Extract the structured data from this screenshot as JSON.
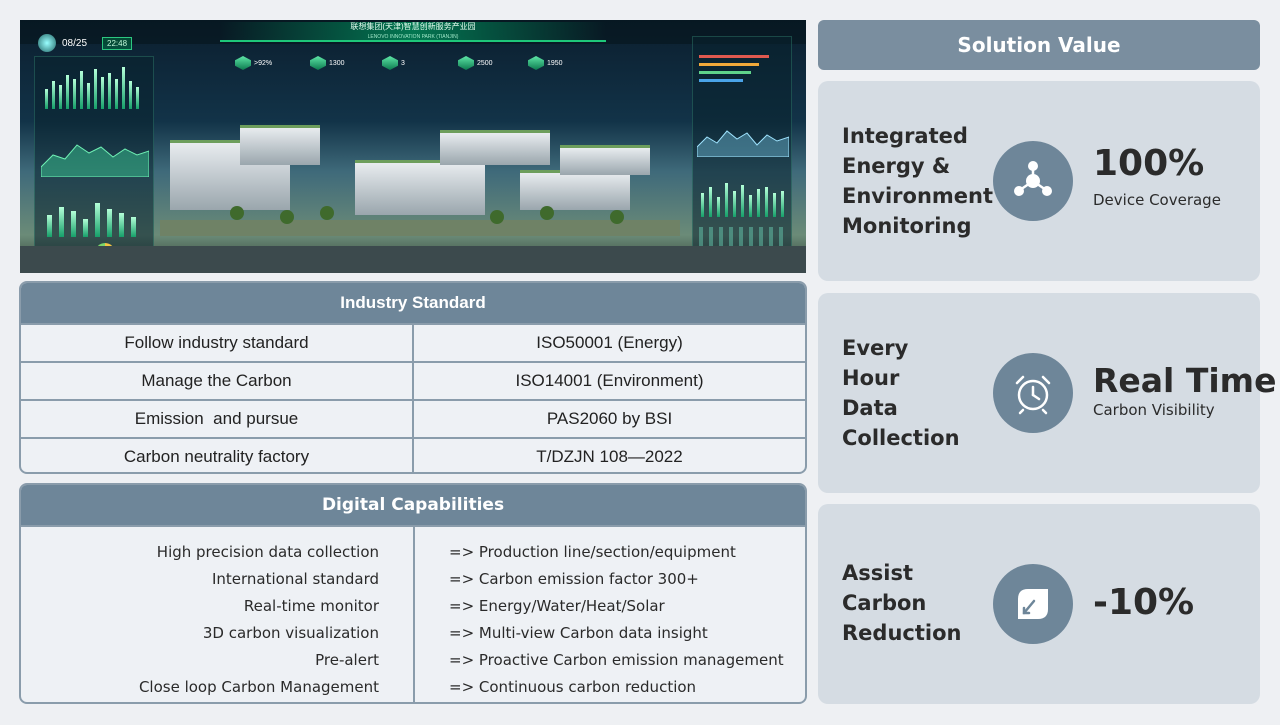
{
  "dashboard": {
    "title": "联想集团(天津)智慧创新服务产业园",
    "subtitle": "LENOVO INNOVATION PARK (TIANJIN)",
    "date": "08/25",
    "time": "22:48",
    "kpis": [
      {
        "value": ">92%"
      },
      {
        "value": "1300"
      },
      {
        "value": "3"
      },
      {
        "value": "2500"
      },
      {
        "value": "1950"
      }
    ]
  },
  "industry_standard": {
    "title": "Industry Standard",
    "rows": [
      {
        "left": "Follow industry standard",
        "right": "ISO50001 (Energy)"
      },
      {
        "left": "Manage the Carbon",
        "right": "ISO14001 (Environment)"
      },
      {
        "left": "Emission  and pursue",
        "right": "PAS2060 by BSI"
      },
      {
        "left": "Carbon neutrality factory",
        "right": "T/DZJN 108—2022"
      }
    ]
  },
  "digital_capabilities": {
    "title": "Digital Capabilities",
    "rows": [
      {
        "left": "High precision data collection",
        "right": "=> Production line/section/equipment"
      },
      {
        "left": "International standard",
        "right": "=> Carbon emission factor 300+"
      },
      {
        "left": "Real-time monitor",
        "right": "=> Energy/Water/Heat/Solar"
      },
      {
        "left": "3D carbon visualization",
        "right": "=> Multi-view Carbon data insight"
      },
      {
        "left": "Pre-alert",
        "right": "=> Proactive Carbon emission management"
      },
      {
        "left": "Close loop Carbon Management",
        "right": "=> Continuous carbon reduction"
      }
    ]
  },
  "solution_value": {
    "title": "Solution Value",
    "cards": [
      {
        "title_lines": [
          "Integrated",
          "Energy &",
          "Environment",
          "Monitoring"
        ],
        "icon": "network-nodes-icon",
        "big": "100%",
        "small": "Device Coverage"
      },
      {
        "title_lines": [
          "Every",
          "Hour",
          "Data",
          "Collection"
        ],
        "icon": "alarm-clock-icon",
        "big": "Real Time",
        "small": "Carbon Visibility"
      },
      {
        "title_lines": [
          "Assist",
          "Carbon",
          "Reduction"
        ],
        "icon": "leaf-down-icon",
        "big": "-10%",
        "small": ""
      }
    ]
  },
  "colors": {
    "header": "#6e8699",
    "card": "#d5dce3",
    "border": "#8a9cab",
    "accent_green": "#1ec77a"
  }
}
